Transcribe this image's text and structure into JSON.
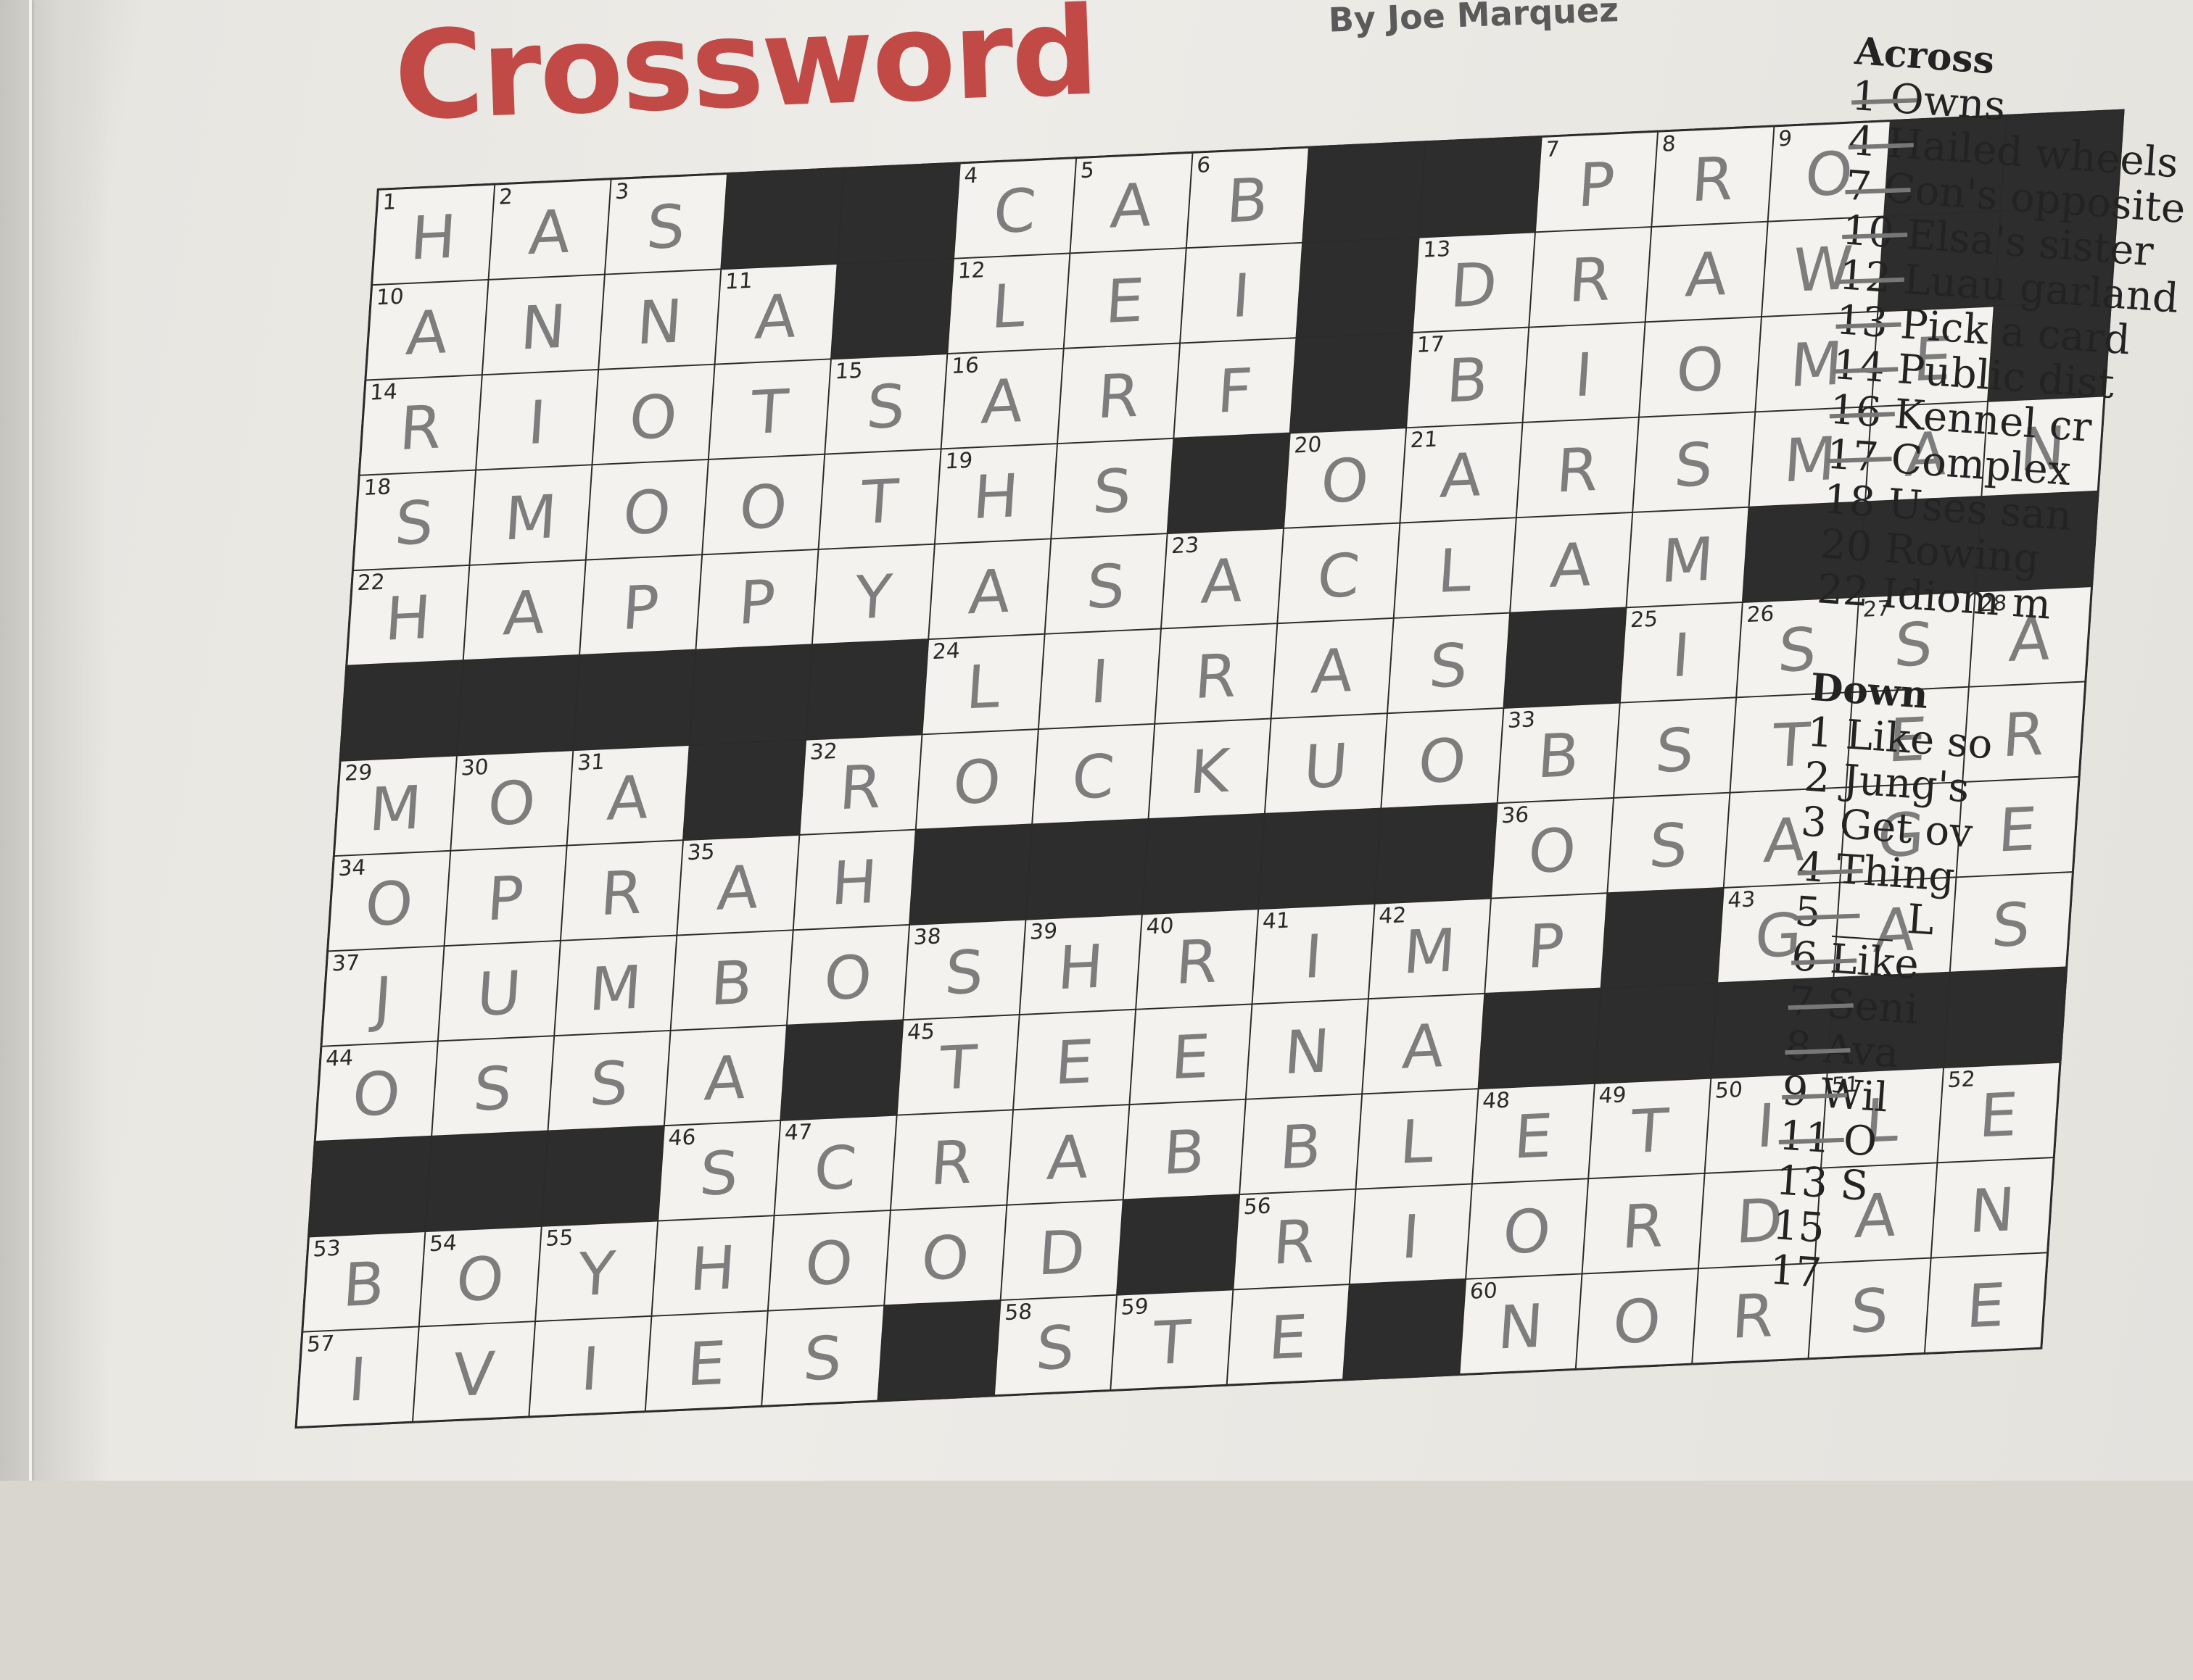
{
  "header": {
    "title": "Crossword",
    "byline": "By Joe Marquez"
  },
  "grid": {
    "rows": [
      [
        {
          "b": 0,
          "n": "1",
          "l": "H"
        },
        {
          "b": 0,
          "n": "2",
          "l": "A"
        },
        {
          "b": 0,
          "n": "3",
          "l": "S"
        },
        {
          "b": 1
        },
        {
          "b": 1
        },
        {
          "b": 0,
          "n": "4",
          "l": "C"
        },
        {
          "b": 0,
          "n": "5",
          "l": "A"
        },
        {
          "b": 0,
          "n": "6",
          "l": "B"
        },
        {
          "b": 1
        },
        {
          "b": 1
        },
        {
          "b": 0,
          "n": "7",
          "l": "P"
        },
        {
          "b": 0,
          "n": "8",
          "l": "R"
        },
        {
          "b": 0,
          "n": "9",
          "l": "O"
        },
        {
          "b": 1
        },
        {
          "b": 1
        }
      ],
      [
        {
          "b": 0,
          "n": "10",
          "l": "A"
        },
        {
          "b": 0,
          "l": "N"
        },
        {
          "b": 0,
          "l": "N"
        },
        {
          "b": 0,
          "n": "11",
          "l": "A"
        },
        {
          "b": 1
        },
        {
          "b": 0,
          "n": "12",
          "l": "L"
        },
        {
          "b": 0,
          "l": "E"
        },
        {
          "b": 0,
          "l": "I"
        },
        {
          "b": 1
        },
        {
          "b": 0,
          "n": "13",
          "l": "D"
        },
        {
          "b": 0,
          "l": "R"
        },
        {
          "b": 0,
          "l": "A"
        },
        {
          "b": 0,
          "l": "W"
        },
        {
          "b": 1
        },
        {
          "b": 1
        }
      ],
      [
        {
          "b": 0,
          "n": "14",
          "l": "R"
        },
        {
          "b": 0,
          "l": "I"
        },
        {
          "b": 0,
          "l": "O"
        },
        {
          "b": 0,
          "l": "T"
        },
        {
          "b": 0,
          "n": "15",
          "l": "S"
        },
        {
          "b": 0,
          "n": "16",
          "l": "A"
        },
        {
          "b": 0,
          "l": "R"
        },
        {
          "b": 0,
          "l": "F"
        },
        {
          "b": 1
        },
        {
          "b": 0,
          "n": "17",
          "l": "B"
        },
        {
          "b": 0,
          "l": "I"
        },
        {
          "b": 0,
          "l": "O"
        },
        {
          "b": 0,
          "l": "M"
        },
        {
          "b": 0,
          "l": "E"
        },
        {
          "b": 1
        }
      ],
      [
        {
          "b": 0,
          "n": "18",
          "l": "S"
        },
        {
          "b": 0,
          "l": "M"
        },
        {
          "b": 0,
          "l": "O"
        },
        {
          "b": 0,
          "l": "O"
        },
        {
          "b": 0,
          "l": "T"
        },
        {
          "b": 0,
          "n": "19",
          "l": "H"
        },
        {
          "b": 0,
          "l": "S"
        },
        {
          "b": 1
        },
        {
          "b": 0,
          "n": "20",
          "l": "O"
        },
        {
          "b": 0,
          "n": "21",
          "l": "A"
        },
        {
          "b": 0,
          "l": "R"
        },
        {
          "b": 0,
          "l": "S"
        },
        {
          "b": 0,
          "l": "M"
        },
        {
          "b": 0,
          "l": "A"
        },
        {
          "b": 0,
          "l": "N"
        }
      ],
      [
        {
          "b": 0,
          "n": "22",
          "l": "H"
        },
        {
          "b": 0,
          "l": "A"
        },
        {
          "b": 0,
          "l": "P"
        },
        {
          "b": 0,
          "l": "P"
        },
        {
          "b": 0,
          "l": "Y"
        },
        {
          "b": 0,
          "l": "A"
        },
        {
          "b": 0,
          "l": "S"
        },
        {
          "b": 0,
          "n": "23",
          "l": "A"
        },
        {
          "b": 0,
          "l": "C"
        },
        {
          "b": 0,
          "l": "L"
        },
        {
          "b": 0,
          "l": "A"
        },
        {
          "b": 0,
          "l": "M"
        },
        {
          "b": 1
        },
        {
          "b": 1
        },
        {
          "b": 1
        }
      ],
      [
        {
          "b": 1
        },
        {
          "b": 1
        },
        {
          "b": 1
        },
        {
          "b": 1
        },
        {
          "b": 1
        },
        {
          "b": 0,
          "n": "24",
          "l": "L"
        },
        {
          "b": 0,
          "l": "I"
        },
        {
          "b": 0,
          "l": "R"
        },
        {
          "b": 0,
          "l": "A"
        },
        {
          "b": 0,
          "l": "S"
        },
        {
          "b": 1
        },
        {
          "b": 0,
          "n": "25",
          "l": "I"
        },
        {
          "b": 0,
          "n": "26",
          "l": "S"
        },
        {
          "b": 0,
          "n": "27",
          "l": "S"
        },
        {
          "b": 0,
          "n": "28",
          "l": "A"
        }
      ],
      [
        {
          "b": 0,
          "n": "29",
          "l": "M"
        },
        {
          "b": 0,
          "n": "30",
          "l": "O"
        },
        {
          "b": 0,
          "n": "31",
          "l": "A"
        },
        {
          "b": 1
        },
        {
          "b": 0,
          "n": "32",
          "l": "R"
        },
        {
          "b": 0,
          "l": "O"
        },
        {
          "b": 0,
          "l": "C"
        },
        {
          "b": 0,
          "l": "K"
        },
        {
          "b": 0,
          "l": "U"
        },
        {
          "b": 0,
          "l": "O"
        },
        {
          "b": 0,
          "n": "33",
          "l": "B"
        },
        {
          "b": 0,
          "l": "S"
        },
        {
          "b": 0,
          "l": "T"
        },
        {
          "b": 0,
          "l": "E"
        },
        {
          "b": 0,
          "l": "R"
        }
      ],
      [
        {
          "b": 0,
          "n": "34",
          "l": "O"
        },
        {
          "b": 0,
          "l": "P"
        },
        {
          "b": 0,
          "l": "R"
        },
        {
          "b": 0,
          "n": "35",
          "l": "A"
        },
        {
          "b": 0,
          "l": "H"
        },
        {
          "b": 1
        },
        {
          "b": 1
        },
        {
          "b": 1
        },
        {
          "b": 1
        },
        {
          "b": 1
        },
        {
          "b": 0,
          "n": "36",
          "l": "O"
        },
        {
          "b": 0,
          "l": "S"
        },
        {
          "b": 0,
          "l": "A"
        },
        {
          "b": 0,
          "l": "G"
        },
        {
          "b": 0,
          "l": "E"
        }
      ],
      [
        {
          "b": 0,
          "n": "37",
          "l": "J"
        },
        {
          "b": 0,
          "l": "U"
        },
        {
          "b": 0,
          "l": "M"
        },
        {
          "b": 0,
          "l": "B"
        },
        {
          "b": 0,
          "l": "O"
        },
        {
          "b": 0,
          "n": "38",
          "l": "S"
        },
        {
          "b": 0,
          "n": "39",
          "l": "H"
        },
        {
          "b": 0,
          "n": "40",
          "l": "R"
        },
        {
          "b": 0,
          "n": "41",
          "l": "I"
        },
        {
          "b": 0,
          "n": "42",
          "l": "M"
        },
        {
          "b": 0,
          "l": "P"
        },
        {
          "b": 1
        },
        {
          "b": 0,
          "n": "43",
          "l": "G"
        },
        {
          "b": 0,
          "l": "A"
        },
        {
          "b": 0,
          "l": "S"
        }
      ],
      [
        {
          "b": 0,
          "n": "44",
          "l": "O"
        },
        {
          "b": 0,
          "l": "S"
        },
        {
          "b": 0,
          "l": "S"
        },
        {
          "b": 0,
          "l": "A"
        },
        {
          "b": 1
        },
        {
          "b": 0,
          "n": "45",
          "l": "T"
        },
        {
          "b": 0,
          "l": "E"
        },
        {
          "b": 0,
          "l": "E"
        },
        {
          "b": 0,
          "l": "N"
        },
        {
          "b": 0,
          "l": "A"
        },
        {
          "b": 1
        },
        {
          "b": 1
        },
        {
          "b": 1
        },
        {
          "b": 1
        },
        {
          "b": 1
        }
      ],
      [
        {
          "b": 1
        },
        {
          "b": 1
        },
        {
          "b": 1
        },
        {
          "b": 0,
          "n": "46",
          "l": "S"
        },
        {
          "b": 0,
          "n": "47",
          "l": "C"
        },
        {
          "b": 0,
          "l": "R"
        },
        {
          "b": 0,
          "l": "A"
        },
        {
          "b": 0,
          "l": "B"
        },
        {
          "b": 0,
          "l": "B"
        },
        {
          "b": 0,
          "l": "L"
        },
        {
          "b": 0,
          "n": "48",
          "l": "E"
        },
        {
          "b": 0,
          "n": "49",
          "l": "T"
        },
        {
          "b": 0,
          "n": "50",
          "l": "I"
        },
        {
          "b": 0,
          "n": "51",
          "l": "L"
        },
        {
          "b": 0,
          "n": "52",
          "l": "E"
        }
      ],
      [
        {
          "b": 0,
          "n": "53",
          "l": "B"
        },
        {
          "b": 0,
          "n": "54",
          "l": "O"
        },
        {
          "b": 0,
          "n": "55",
          "l": "Y"
        },
        {
          "b": 0,
          "l": "H"
        },
        {
          "b": 0,
          "l": "O"
        },
        {
          "b": 0,
          "l": "O"
        },
        {
          "b": 0,
          "l": "D"
        },
        {
          "b": 1
        },
        {
          "b": 0,
          "n": "56",
          "l": "R"
        },
        {
          "b": 0,
          "l": "I"
        },
        {
          "b": 0,
          "l": "O"
        },
        {
          "b": 0,
          "l": "R"
        },
        {
          "b": 0,
          "l": "D"
        },
        {
          "b": 0,
          "l": "A"
        },
        {
          "b": 0,
          "l": "N"
        }
      ],
      [
        {
          "b": 0,
          "n": "57",
          "l": "I"
        },
        {
          "b": 0,
          "l": "V"
        },
        {
          "b": 0,
          "l": "I"
        },
        {
          "b": 0,
          "l": "E"
        },
        {
          "b": 0,
          "l": "S"
        },
        {
          "b": 1
        },
        {
          "b": 0,
          "n": "58",
          "l": "S"
        },
        {
          "b": 0,
          "n": "59",
          "l": "T"
        },
        {
          "b": 0,
          "l": "E"
        },
        {
          "b": 1
        },
        {
          "b": 0,
          "n": "60",
          "l": "N"
        },
        {
          "b": 0,
          "l": "O"
        },
        {
          "b": 0,
          "l": "R"
        },
        {
          "b": 0,
          "l": "S"
        },
        {
          "b": 0,
          "l": "E"
        }
      ]
    ]
  },
  "clues": {
    "across_heading": "Across",
    "across": [
      {
        "text": "1 Owns",
        "crossed": true
      },
      {
        "text": "4 Hailed wheels",
        "crossed": true
      },
      {
        "text": "7 Con's opposite",
        "crossed": true
      },
      {
        "text": "10 Elsa's sister",
        "crossed": true
      },
      {
        "text": "12 Luau garland",
        "crossed": true
      },
      {
        "text": "13 Pick a card",
        "crossed": true
      },
      {
        "text": "14 Public dist",
        "crossed": true
      },
      {
        "text": "16 Kennel cr",
        "crossed": true
      },
      {
        "text": "17 Complex",
        "crossed": true
      },
      {
        "text": "18 Uses san",
        "crossed": false
      },
      {
        "text": "20 Rowing",
        "crossed": false
      },
      {
        "text": "22 Idiom m",
        "crossed": false
      }
    ],
    "down_heading": "Down",
    "down": [
      {
        "text": "1 Like so",
        "crossed": false
      },
      {
        "text": "2 Jung's",
        "crossed": false
      },
      {
        "text": "3 Get ov",
        "crossed": false
      },
      {
        "text": "4 Thing",
        "crossed": true
      },
      {
        "text": "5 ___ L",
        "crossed": true
      },
      {
        "text": "6 Like",
        "crossed": true
      },
      {
        "text": "7 Seni",
        "crossed": true
      },
      {
        "text": "8 Ava",
        "crossed": true
      },
      {
        "text": "9 Wil",
        "crossed": true
      },
      {
        "text": "11 O",
        "crossed": true
      },
      {
        "text": "13 S",
        "crossed": false
      },
      {
        "text": "15",
        "crossed": false
      },
      {
        "text": "17",
        "crossed": false
      }
    ]
  }
}
